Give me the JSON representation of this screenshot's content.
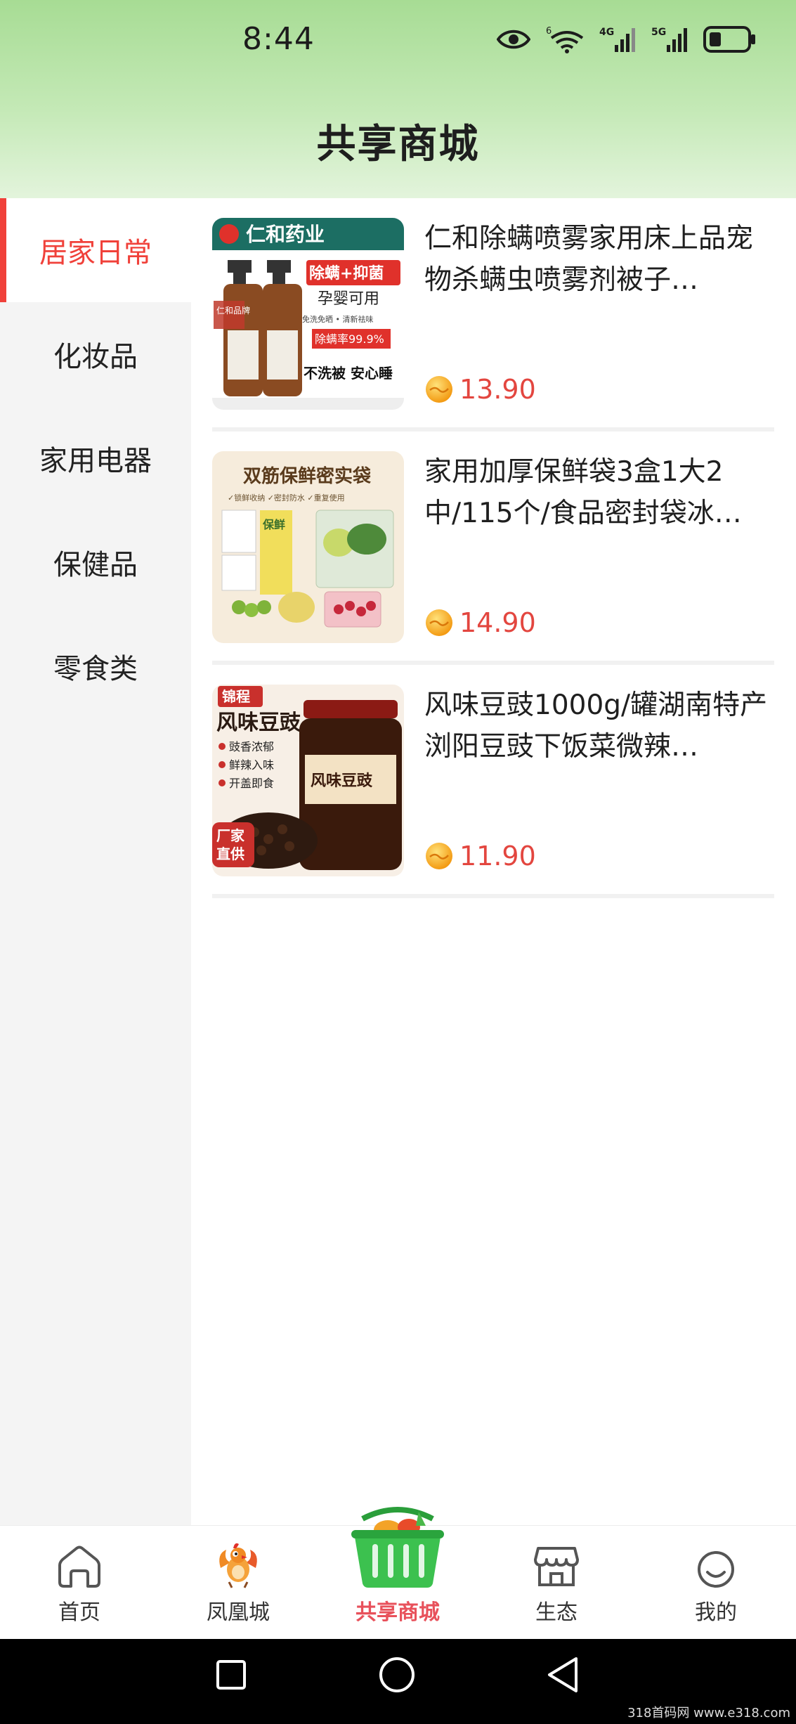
{
  "status_bar": {
    "time": "8:44",
    "wifi_tag": "6",
    "net1": "4G",
    "net2": "5G"
  },
  "header": {
    "title": "共享商城"
  },
  "categories": [
    {
      "label": "居家日常",
      "active": true
    },
    {
      "label": "化妆品"
    },
    {
      "label": "家用电器"
    },
    {
      "label": "保健品"
    },
    {
      "label": "零食类"
    }
  ],
  "products": [
    {
      "title": "仁和除螨喷雾家用床上品宠物杀螨虫喷雾剂被子…",
      "price": "13.90",
      "image": {
        "brand": "仁和药业",
        "tag1": "除螨+抑菌",
        "tag2": "孕婴可用",
        "tag3": "免洗免晒 • 清新祛味",
        "tag4": "除螨率99.9%",
        "tag5": "不洗被 安心睡",
        "side": "仁和品牌"
      }
    },
    {
      "title": "家用加厚保鲜袋3盒1大2中/115个/食品密封袋冰…",
      "price": "14.90",
      "image": {
        "headline": "双筋保鲜密实袋",
        "features": "✓锁鲜收纳  ✓密封防水  ✓重复使用",
        "bag_label": "保鲜"
      }
    },
    {
      "title": "风味豆豉1000g/罐湖南特产浏阳豆豉下饭菜微辣…",
      "price": "11.90",
      "image": {
        "brand": "锦程",
        "headline": "风味豆豉",
        "points": [
          "豉香浓郁",
          "鲜辣入味",
          "开盖即食"
        ],
        "badge_line1": "厂家",
        "badge_line2": "直供",
        "jar_label": "风味豆豉"
      }
    }
  ],
  "bottom_nav": [
    {
      "label": "首页",
      "icon": "home-icon"
    },
    {
      "label": "凤凰城",
      "icon": "phoenix-icon"
    },
    {
      "label": "共享商城",
      "icon": "shopping-basket-icon",
      "active": true
    },
    {
      "label": "生态",
      "icon": "store-icon"
    },
    {
      "label": "我的",
      "icon": "smiley-icon"
    }
  ],
  "watermark": "318首码网 www.e318.com",
  "colors": {
    "accent": "#f0413a",
    "price": "#e3463f",
    "header_green": "#a7dc94"
  }
}
